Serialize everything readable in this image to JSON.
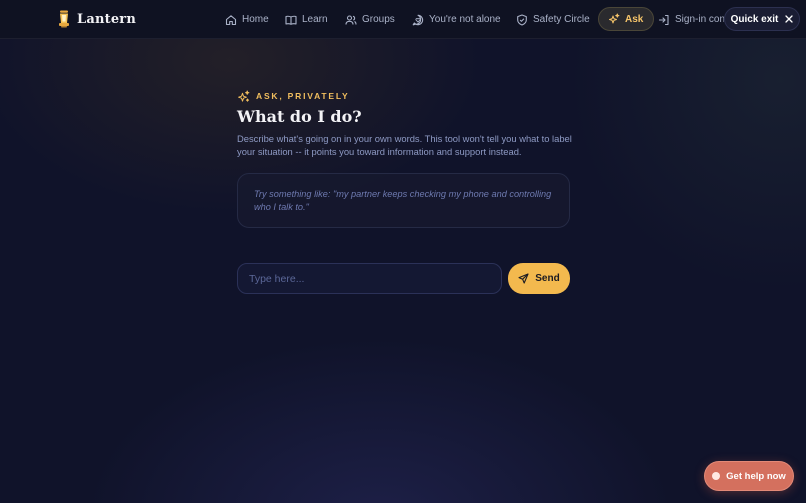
{
  "brand": {
    "name": "Lantern",
    "icon": "lantern-icon"
  },
  "nav": {
    "items": [
      {
        "label": "Home",
        "icon": "home-icon"
      },
      {
        "label": "Learn",
        "icon": "book-icon"
      },
      {
        "label": "Groups",
        "icon": "users-icon"
      },
      {
        "label": "You're not alone",
        "icon": "heart-chat-icon"
      },
      {
        "label": "Safety Circle",
        "icon": "shield-icon"
      },
      {
        "label": "Ask",
        "icon": "sparkles-icon",
        "active": true
      }
    ],
    "signin_label": "Sign-in con",
    "quick_exit_label": "Quick exit"
  },
  "main": {
    "eyebrow": "ASK, PRIVATELY",
    "title": "What do I do?",
    "description": "Describe what's going on in your own words. This tool won't tell you what to label your situation -- it points you toward information and support instead.",
    "sample_prompt": "Try something like: \"my partner keeps checking my phone and controlling who I talk to.\"",
    "input_placeholder": "Type here...",
    "send_label": "Send"
  },
  "help_button_label": "Get help now",
  "colors": {
    "accent": "#f3b94e",
    "background": "#10132a",
    "help_button": "#d4705e"
  }
}
